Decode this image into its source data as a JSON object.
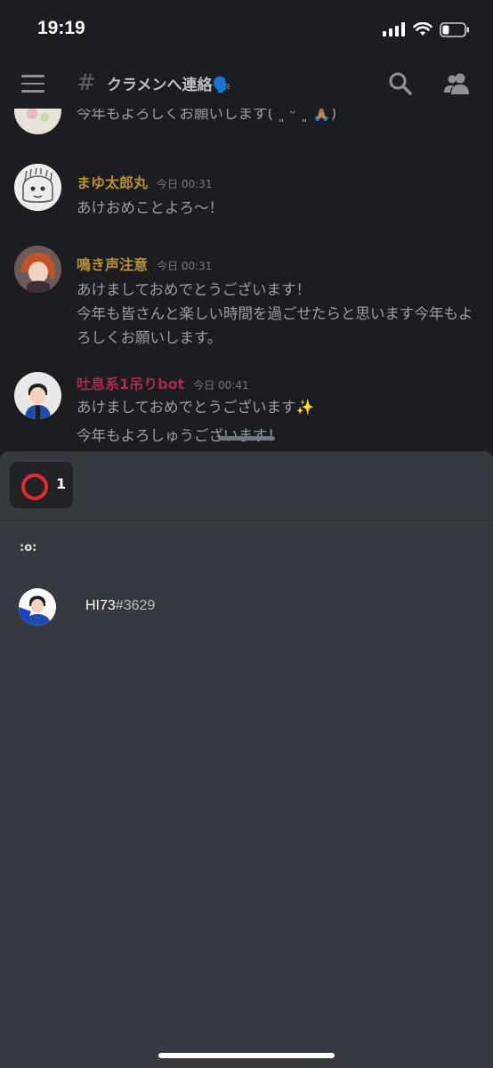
{
  "status_bar": {
    "time": "19:19",
    "battery_level": 0.3
  },
  "header": {
    "hash_icon": "#",
    "channel_name": "クラメンへ連絡🗣️"
  },
  "messages": [
    {
      "author": "",
      "timestamp": "",
      "lines": [
        "今年もよろしくお願いします( ˘͈ ᵕ ˘͈ 🙏🏽)"
      ]
    },
    {
      "author": "まゆ太郎丸",
      "author_color": "#b8902a",
      "timestamp": "今日 00:31",
      "lines": [
        "あけおめことよろ〜！"
      ]
    },
    {
      "author": "鳴き声注意",
      "author_color": "#b8902a",
      "timestamp": "今日 00:31",
      "lines": [
        "あけましておめでとうございます！",
        "今年も皆さんと楽しい時間を過ごせたらと思います今年もよろしくお願いします。"
      ]
    },
    {
      "author": "吐息系1吊りbot",
      "author_color": "#a8294f",
      "timestamp": "今日 00:41",
      "lines": [
        "あけましておめでとうございます✨",
        "今年もよろしゅうございます！"
      ]
    }
  ],
  "reaction_sheet": {
    "reaction": {
      "emoji": "⭕",
      "count": "1"
    },
    "emoji_code": ":o:",
    "reactors": [
      {
        "name": "HI73",
        "tag": "#3629"
      }
    ]
  }
}
